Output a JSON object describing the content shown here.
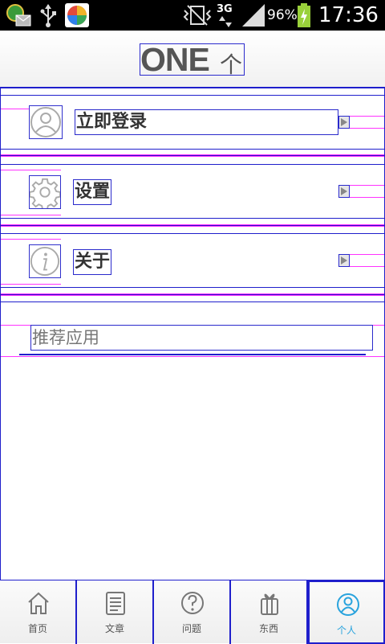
{
  "status_bar": {
    "network": "3G",
    "battery": "96%",
    "time": "17:36"
  },
  "header": {
    "logo_text": "ONE",
    "logo_cn": "个"
  },
  "menu": [
    {
      "label": "立即登录",
      "icon": "user-icon"
    },
    {
      "label": "设置",
      "icon": "gear-icon"
    },
    {
      "label": "关于",
      "icon": "info-icon"
    }
  ],
  "recommend": {
    "label": "推荐应用"
  },
  "tabs": [
    {
      "label": "首页",
      "icon": "home-icon",
      "active": false
    },
    {
      "label": "文章",
      "icon": "article-icon",
      "active": false
    },
    {
      "label": "问题",
      "icon": "question-icon",
      "active": false
    },
    {
      "label": "东西",
      "icon": "gift-icon",
      "active": false
    },
    {
      "label": "个人",
      "icon": "person-icon",
      "active": true
    }
  ],
  "colors": {
    "accent": "#29a3dd",
    "outline": "#1f1fcc",
    "guide": "#ff33ff"
  }
}
